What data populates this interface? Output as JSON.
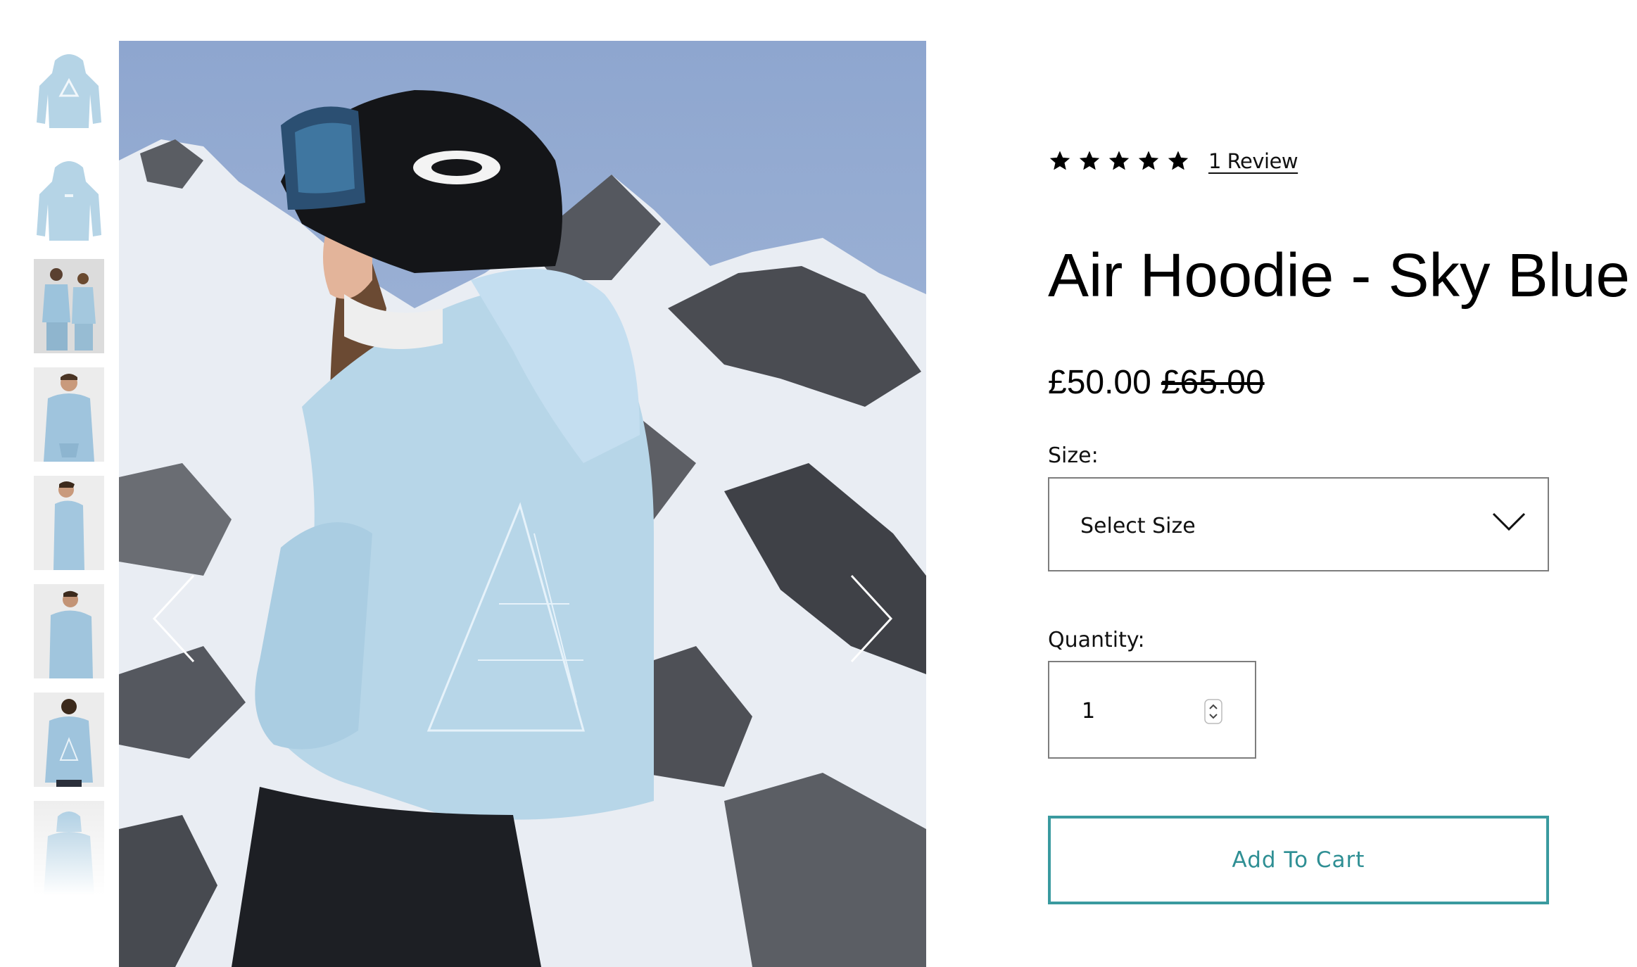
{
  "gallery": {
    "thumbnails": [
      {
        "name": "hoodie front"
      },
      {
        "name": "hoodie back"
      },
      {
        "name": "two models"
      },
      {
        "name": "model front"
      },
      {
        "name": "model side"
      },
      {
        "name": "model three-quarter"
      },
      {
        "name": "model back"
      },
      {
        "name": "model hood up"
      }
    ]
  },
  "product": {
    "rating": {
      "stars": 5,
      "review_link": "1 Review"
    },
    "title": "Air Hoodie - Sky Blue",
    "price": {
      "current": "£50.00",
      "original": "£65.00"
    },
    "size": {
      "label": "Size:",
      "selected": "Select Size"
    },
    "quantity": {
      "label": "Quantity:",
      "value": "1"
    },
    "add_to_cart": "Add To Cart"
  },
  "colors": {
    "accent": "#3a9a9f",
    "hoodie": "#b7d6e8"
  }
}
